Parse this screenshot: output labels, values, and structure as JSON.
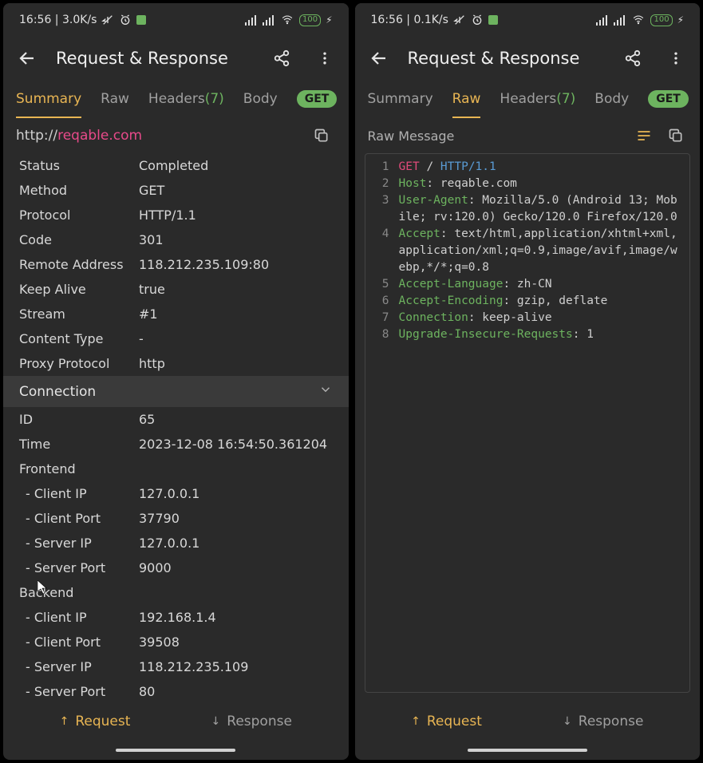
{
  "statusbar": {
    "time_left": "16:56 | 3.0K/s",
    "time_right": "16:56 | 0.1K/s",
    "battery": "100"
  },
  "appbar": {
    "title": "Request & Response"
  },
  "tabs": {
    "summary": "Summary",
    "raw": "Raw",
    "headers_label": "Headers",
    "headers_count": "(7)",
    "body": "Body"
  },
  "method_badge": "GET",
  "url": {
    "scheme": "http://",
    "host": "reqable.com"
  },
  "summary": {
    "rows": [
      {
        "key": "Status",
        "val": "Completed"
      },
      {
        "key": "Method",
        "val": "GET"
      },
      {
        "key": "Protocol",
        "val": "HTTP/1.1"
      },
      {
        "key": "Code",
        "val": "301"
      },
      {
        "key": "Remote Address",
        "val": "118.212.235.109:80"
      },
      {
        "key": "Keep Alive",
        "val": "true"
      },
      {
        "key": "Stream",
        "val": "#1"
      },
      {
        "key": "Content Type",
        "val": "-"
      },
      {
        "key": "Proxy Protocol",
        "val": "http"
      }
    ],
    "connection_header": "Connection",
    "conn_rows": [
      {
        "key": "ID",
        "val": "65"
      },
      {
        "key": "Time",
        "val": "2023-12-08 16:54:50.361204"
      }
    ],
    "frontend_label": "Frontend",
    "frontend": [
      {
        "key": "Client IP",
        "val": "127.0.0.1"
      },
      {
        "key": "Client Port",
        "val": "37790"
      },
      {
        "key": "Server IP",
        "val": "127.0.0.1"
      },
      {
        "key": "Server Port",
        "val": "9000"
      }
    ],
    "backend_label": "Backend",
    "backend": [
      {
        "key": "Client IP",
        "val": "192.168.1.4"
      },
      {
        "key": "Client Port",
        "val": "39508"
      },
      {
        "key": "Server IP",
        "val": "118.212.235.109"
      },
      {
        "key": "Server Port",
        "val": "80"
      }
    ]
  },
  "raw": {
    "heading": "Raw Message",
    "lines": [
      {
        "n": "1",
        "method": "GET",
        "path": "/",
        "proto": "HTTP/1.1"
      },
      {
        "n": "2",
        "header": "Host",
        "val": "reqable.com"
      },
      {
        "n": "3",
        "header": "User-Agent",
        "val": "Mozilla/5.0 (Android 13; Mobile; rv:120.0) Gecko/120.0 Firefox/120.0"
      },
      {
        "n": "4",
        "header": "Accept",
        "val": "text/html,application/xhtml+xml,application/xml;q=0.9,image/avif,image/webp,*/*;q=0.8"
      },
      {
        "n": "5",
        "header": "Accept-Language",
        "val": "zh-CN"
      },
      {
        "n": "6",
        "header": "Accept-Encoding",
        "val": "gzip, deflate"
      },
      {
        "n": "7",
        "header": "Connection",
        "val": "keep-alive"
      },
      {
        "n": "8",
        "header": "Upgrade-Insecure-Requests",
        "val": "1"
      }
    ]
  },
  "bottombar": {
    "request": "Request",
    "response": "Response"
  }
}
